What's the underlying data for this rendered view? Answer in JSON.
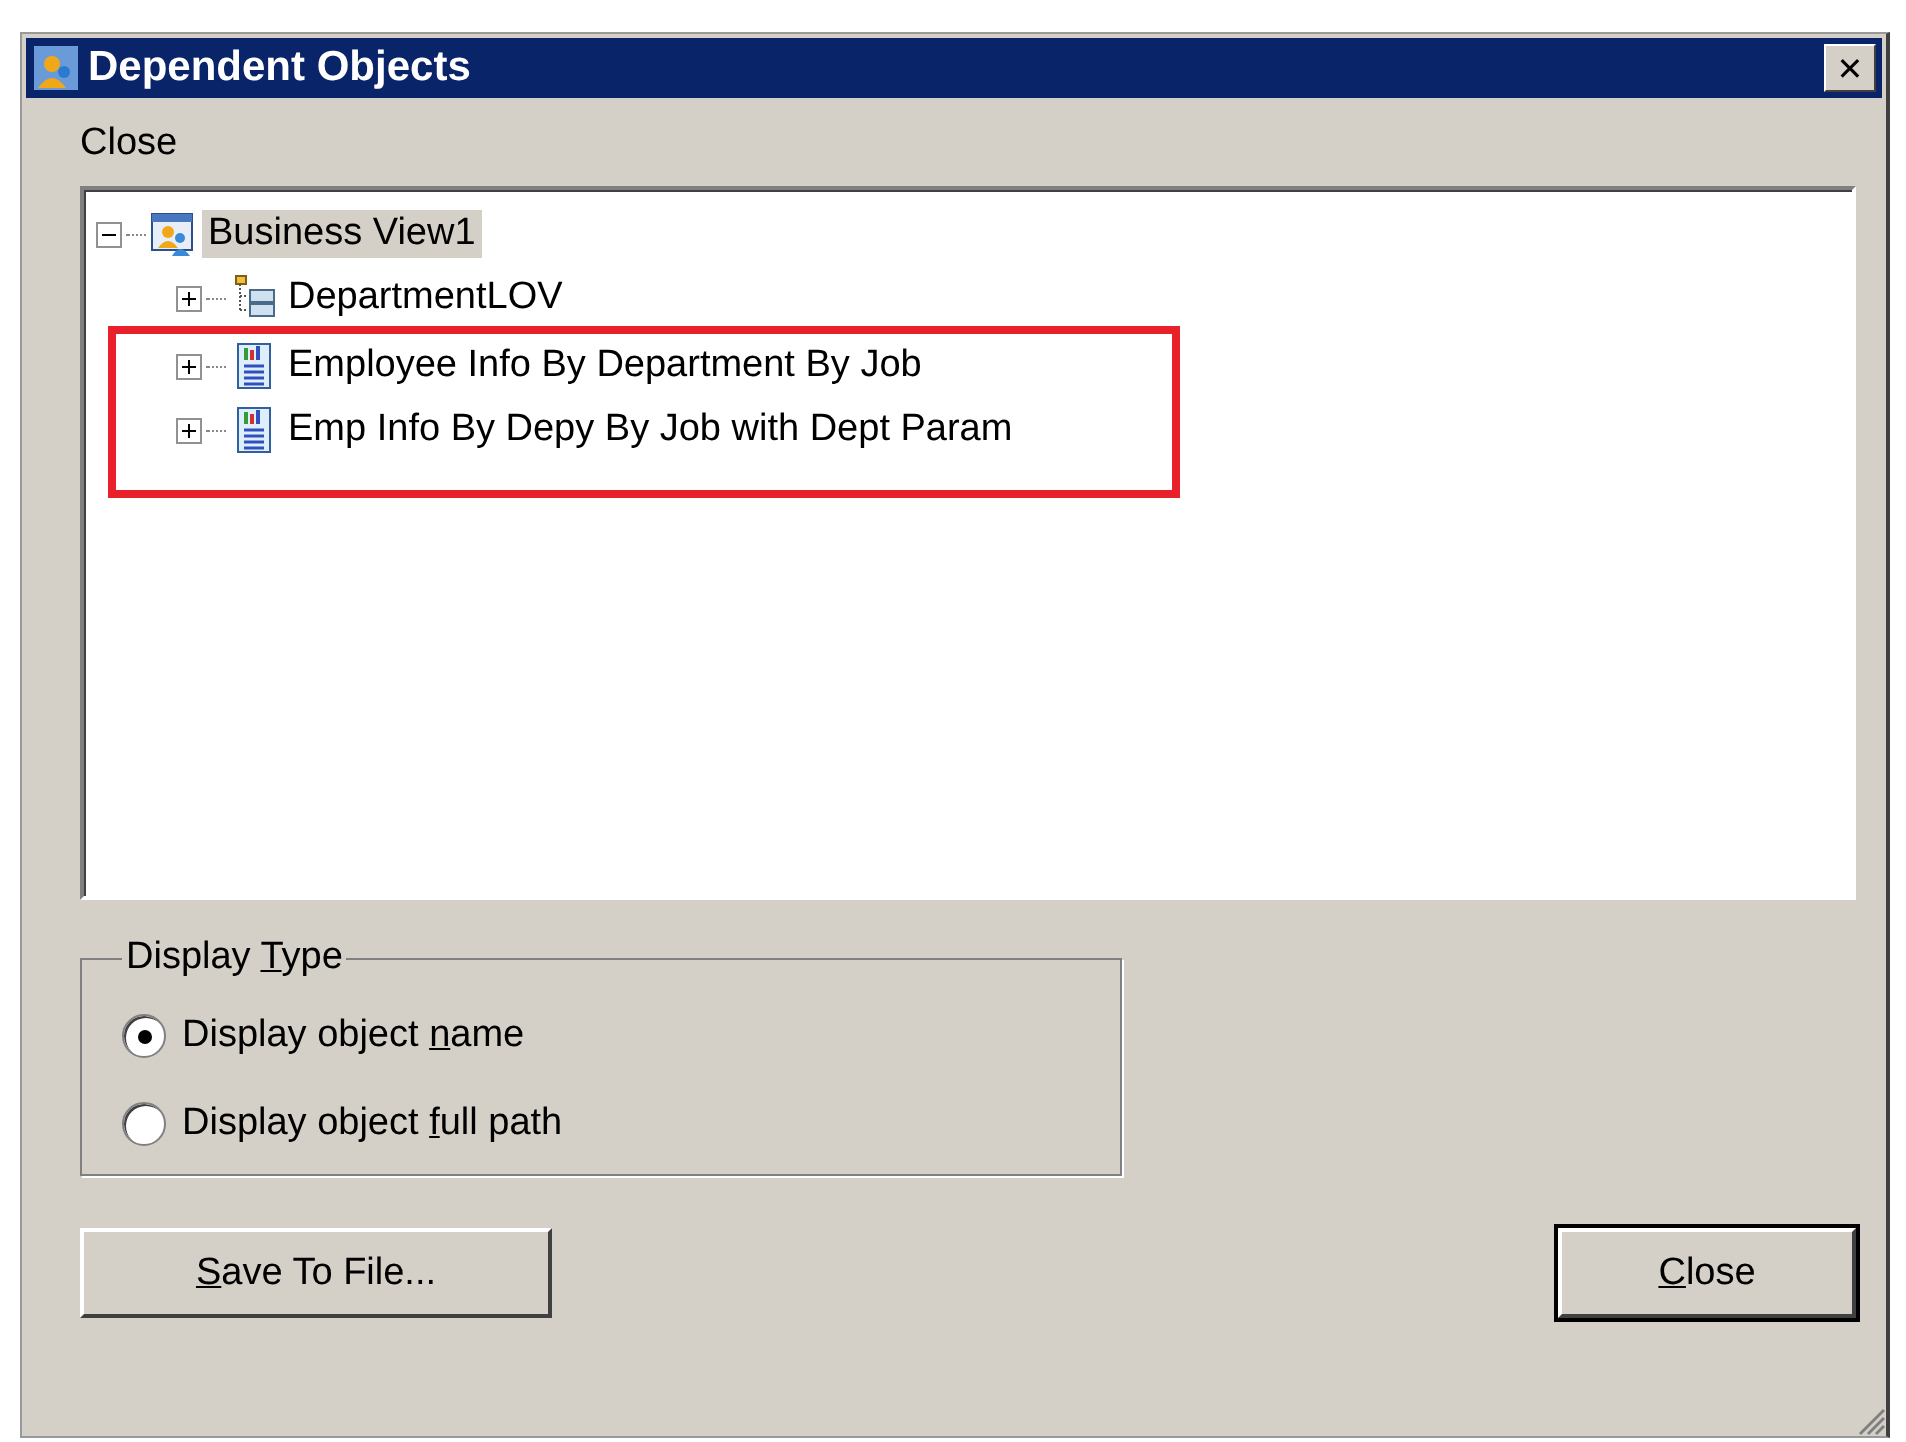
{
  "window": {
    "title": "Dependent Objects",
    "close_glyph": "✕"
  },
  "menu_label": "Close",
  "tree": [
    {
      "label": "Business View1",
      "kind": "business-view",
      "expanded": true,
      "selected": true,
      "highlighted": false,
      "children": [
        {
          "label": "DepartmentLOV",
          "kind": "lov",
          "expanded": false,
          "selected": false,
          "highlighted": false
        },
        {
          "label": "Employee Info By Department By Job",
          "kind": "report",
          "expanded": false,
          "selected": false,
          "highlighted": true
        },
        {
          "label": "Emp Info By Depy By Job with Dept Param",
          "kind": "report",
          "expanded": false,
          "selected": false,
          "highlighted": true
        }
      ]
    }
  ],
  "display_type": {
    "label_parts": {
      "before": "Display ",
      "access_key": "T",
      "after": "ype"
    },
    "options": [
      {
        "label_parts": {
          "before": "Display object ",
          "access_key": "n",
          "after": "ame"
        },
        "selected": true
      },
      {
        "label_parts": {
          "before": "Display object ",
          "access_key": "f",
          "after": "ull path"
        },
        "selected": false
      }
    ]
  },
  "buttons": [
    {
      "label_parts": {
        "access_key": "S",
        "after": "ave To File..."
      },
      "default": false
    },
    {
      "label_parts": {
        "access_key": "C",
        "after": "lose"
      },
      "default": true
    }
  ]
}
